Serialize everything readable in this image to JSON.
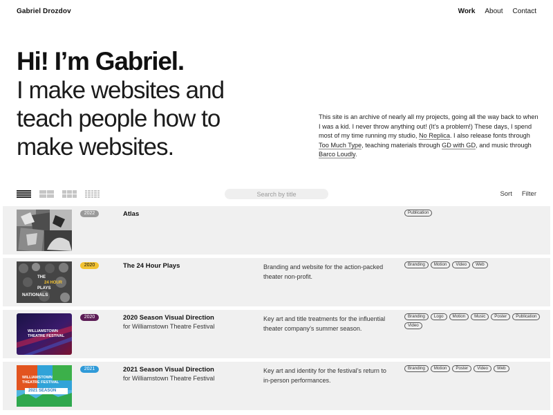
{
  "header": {
    "site_name": "Gabriel Drozdov",
    "nav": [
      "Work",
      "About",
      "Contact"
    ]
  },
  "hero": {
    "greeting": "Hi! I’m Gabriel.",
    "tagline_lines": [
      "I make websites and",
      "teach people how to",
      "make websites."
    ]
  },
  "intro": {
    "part1": "This site is an archive of nearly all my projects, going all the way back to when I was a kid. I never throw anything out! (It’s a problem!) These days, I spend most of my time running my studio, ",
    "link1": "No Replica",
    "part2": ". I also release fonts through ",
    "link2": "Too Much Type",
    "part3": ", teaching materials through ",
    "link3": "GD with GD",
    "part4": ", and music through ",
    "link4": "Barco Loudly",
    "part5": "."
  },
  "controls": {
    "search_placeholder": "Search by title",
    "sort_label": "Sort",
    "filter_label": "Filter"
  },
  "colors": {
    "year_2022": "#9a9a9a",
    "year_2020_a": "#f2c232",
    "year_2020_b": "#5b1c55",
    "year_2021": "#2f9ad8"
  },
  "projects": [
    {
      "year": "2022",
      "title": "Atlas",
      "client": "",
      "description": "",
      "tags": [
        "Publication"
      ],
      "thumb_captions": []
    },
    {
      "year": "2020",
      "title": "The 24 Hour Plays",
      "client": "",
      "description": "Branding and website for the action-packed theater non-profit.",
      "tags": [
        "Branding",
        "Motion",
        "Video",
        "Web"
      ],
      "thumb_captions": [
        "THE",
        "24 HOUR",
        "PLAYS",
        "NATIONALS"
      ]
    },
    {
      "year": "2020",
      "title": "2020 Season Visual Direction",
      "client": "for Williamstown Theatre Festival",
      "description": "Key art and title treatments for the influential theater company’s summer season.",
      "tags": [
        "Branding",
        "Logo",
        "Motion",
        "Music",
        "Poster",
        "Publication",
        "Video"
      ],
      "thumb_captions": [
        "WILLIAMSTOWN",
        "THEATRE FESTIVAL"
      ]
    },
    {
      "year": "2021",
      "title": "2021 Season Visual Direction",
      "client": "for Williamstown Theatre Festival",
      "description": "Key art and identity for the festival’s return to in-person performances.",
      "tags": [
        "Branding",
        "Motion",
        "Poster",
        "Video",
        "Web"
      ],
      "thumb_captions": [
        "WILLIAMSTOWN",
        "THEATRE FESTIVAL",
        "2021 SEASON"
      ]
    }
  ]
}
